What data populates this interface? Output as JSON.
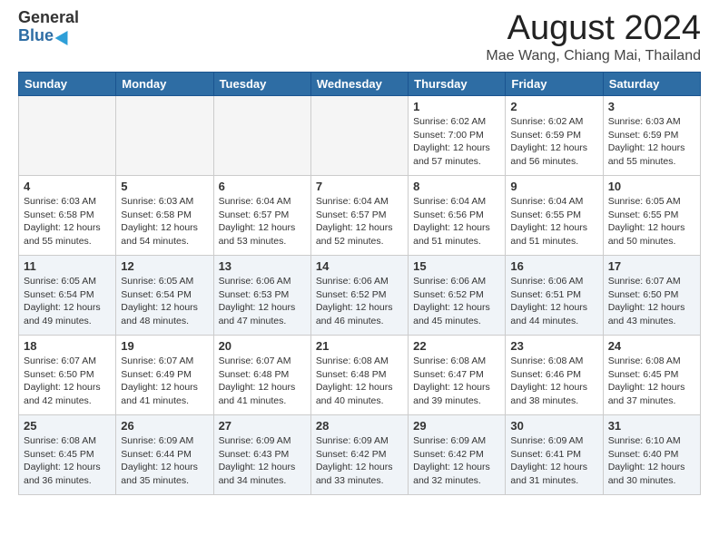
{
  "header": {
    "logo_general": "General",
    "logo_blue": "Blue",
    "title": "August 2024",
    "location": "Mae Wang, Chiang Mai, Thailand"
  },
  "calendar": {
    "days_of_week": [
      "Sunday",
      "Monday",
      "Tuesday",
      "Wednesday",
      "Thursday",
      "Friday",
      "Saturday"
    ],
    "weeks": [
      {
        "shaded": false,
        "days": [
          {
            "num": "",
            "info": ""
          },
          {
            "num": "",
            "info": ""
          },
          {
            "num": "",
            "info": ""
          },
          {
            "num": "",
            "info": ""
          },
          {
            "num": "1",
            "info": "Sunrise: 6:02 AM\nSunset: 7:00 PM\nDaylight: 12 hours and 57 minutes."
          },
          {
            "num": "2",
            "info": "Sunrise: 6:02 AM\nSunset: 6:59 PM\nDaylight: 12 hours and 56 minutes."
          },
          {
            "num": "3",
            "info": "Sunrise: 6:03 AM\nSunset: 6:59 PM\nDaylight: 12 hours and 55 minutes."
          }
        ]
      },
      {
        "shaded": false,
        "days": [
          {
            "num": "4",
            "info": "Sunrise: 6:03 AM\nSunset: 6:58 PM\nDaylight: 12 hours and 55 minutes."
          },
          {
            "num": "5",
            "info": "Sunrise: 6:03 AM\nSunset: 6:58 PM\nDaylight: 12 hours and 54 minutes."
          },
          {
            "num": "6",
            "info": "Sunrise: 6:04 AM\nSunset: 6:57 PM\nDaylight: 12 hours and 53 minutes."
          },
          {
            "num": "7",
            "info": "Sunrise: 6:04 AM\nSunset: 6:57 PM\nDaylight: 12 hours and 52 minutes."
          },
          {
            "num": "8",
            "info": "Sunrise: 6:04 AM\nSunset: 6:56 PM\nDaylight: 12 hours and 51 minutes."
          },
          {
            "num": "9",
            "info": "Sunrise: 6:04 AM\nSunset: 6:55 PM\nDaylight: 12 hours and 51 minutes."
          },
          {
            "num": "10",
            "info": "Sunrise: 6:05 AM\nSunset: 6:55 PM\nDaylight: 12 hours and 50 minutes."
          }
        ]
      },
      {
        "shaded": true,
        "days": [
          {
            "num": "11",
            "info": "Sunrise: 6:05 AM\nSunset: 6:54 PM\nDaylight: 12 hours and 49 minutes."
          },
          {
            "num": "12",
            "info": "Sunrise: 6:05 AM\nSunset: 6:54 PM\nDaylight: 12 hours and 48 minutes."
          },
          {
            "num": "13",
            "info": "Sunrise: 6:06 AM\nSunset: 6:53 PM\nDaylight: 12 hours and 47 minutes."
          },
          {
            "num": "14",
            "info": "Sunrise: 6:06 AM\nSunset: 6:52 PM\nDaylight: 12 hours and 46 minutes."
          },
          {
            "num": "15",
            "info": "Sunrise: 6:06 AM\nSunset: 6:52 PM\nDaylight: 12 hours and 45 minutes."
          },
          {
            "num": "16",
            "info": "Sunrise: 6:06 AM\nSunset: 6:51 PM\nDaylight: 12 hours and 44 minutes."
          },
          {
            "num": "17",
            "info": "Sunrise: 6:07 AM\nSunset: 6:50 PM\nDaylight: 12 hours and 43 minutes."
          }
        ]
      },
      {
        "shaded": false,
        "days": [
          {
            "num": "18",
            "info": "Sunrise: 6:07 AM\nSunset: 6:50 PM\nDaylight: 12 hours and 42 minutes."
          },
          {
            "num": "19",
            "info": "Sunrise: 6:07 AM\nSunset: 6:49 PM\nDaylight: 12 hours and 41 minutes."
          },
          {
            "num": "20",
            "info": "Sunrise: 6:07 AM\nSunset: 6:48 PM\nDaylight: 12 hours and 41 minutes."
          },
          {
            "num": "21",
            "info": "Sunrise: 6:08 AM\nSunset: 6:48 PM\nDaylight: 12 hours and 40 minutes."
          },
          {
            "num": "22",
            "info": "Sunrise: 6:08 AM\nSunset: 6:47 PM\nDaylight: 12 hours and 39 minutes."
          },
          {
            "num": "23",
            "info": "Sunrise: 6:08 AM\nSunset: 6:46 PM\nDaylight: 12 hours and 38 minutes."
          },
          {
            "num": "24",
            "info": "Sunrise: 6:08 AM\nSunset: 6:45 PM\nDaylight: 12 hours and 37 minutes."
          }
        ]
      },
      {
        "shaded": true,
        "days": [
          {
            "num": "25",
            "info": "Sunrise: 6:08 AM\nSunset: 6:45 PM\nDaylight: 12 hours and 36 minutes."
          },
          {
            "num": "26",
            "info": "Sunrise: 6:09 AM\nSunset: 6:44 PM\nDaylight: 12 hours and 35 minutes."
          },
          {
            "num": "27",
            "info": "Sunrise: 6:09 AM\nSunset: 6:43 PM\nDaylight: 12 hours and 34 minutes."
          },
          {
            "num": "28",
            "info": "Sunrise: 6:09 AM\nSunset: 6:42 PM\nDaylight: 12 hours and 33 minutes."
          },
          {
            "num": "29",
            "info": "Sunrise: 6:09 AM\nSunset: 6:42 PM\nDaylight: 12 hours and 32 minutes."
          },
          {
            "num": "30",
            "info": "Sunrise: 6:09 AM\nSunset: 6:41 PM\nDaylight: 12 hours and 31 minutes."
          },
          {
            "num": "31",
            "info": "Sunrise: 6:10 AM\nSunset: 6:40 PM\nDaylight: 12 hours and 30 minutes."
          }
        ]
      }
    ]
  }
}
